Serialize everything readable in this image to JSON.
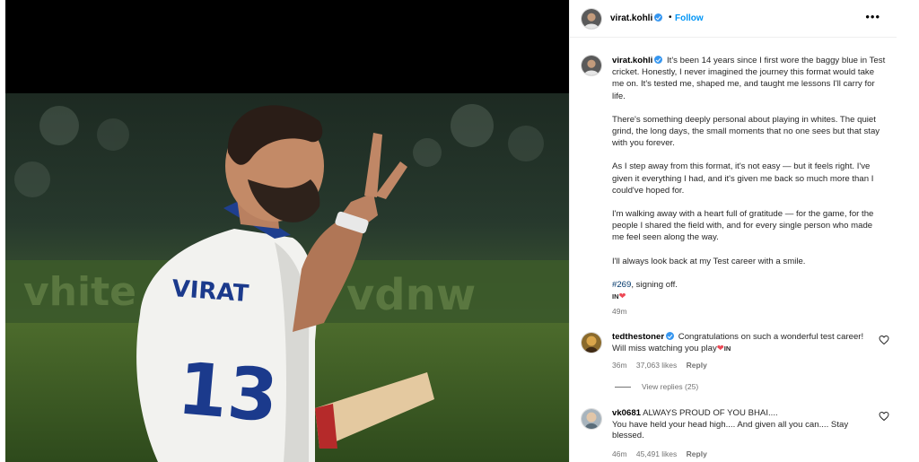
{
  "post": {
    "image_alt": "Virat Kohli in Test whites, number 13, raising two fingers while holding a bat"
  },
  "header": {
    "username": "virat.kohli",
    "separator": "•",
    "follow_label": "Follow",
    "more_label": "•••"
  },
  "caption": {
    "username": "virat.kohli",
    "paragraphs": [
      "It's been 14 years since I first wore the baggy blue in Test cricket. Honestly, I never imagined the journey this format would take me on. It's tested me, shaped me, and taught me lessons I'll carry for life.",
      "There's something deeply personal about playing in whites. The quiet grind, the long days, the small moments that no one sees but that stay with you forever.",
      "As I step away from this format, it's not easy — but it feels right. I've given it everything I had, and it's given me back so much more than I could've hoped for.",
      "I'm walking away with a heart full of gratitude — for the game, for the people I shared the field with, and for every single person who made me feel seen along the way.",
      "I'll always look back at my Test career with a smile."
    ],
    "hashtag": "#269",
    "closing": ", signing off.",
    "flag": "IN",
    "heart": "❤",
    "time": "49m"
  },
  "comments": [
    {
      "username": "tedthestoner",
      "text": "Congratulations on such a wonderful test career! Will miss watching you play",
      "heart": "❤",
      "flag": "IN",
      "time": "36m",
      "likes": "37,063 likes",
      "reply_label": "Reply",
      "view_replies": "View replies (25)"
    },
    {
      "username": "vk0681",
      "text_line1": "ALWAYS PROUD OF YOU BHAI....",
      "text_rest": "You have held your head high.... And given all you can.... Stay blessed.",
      "time": "46m",
      "likes": "45,491 likes",
      "reply_label": "Reply"
    }
  ],
  "colors": {
    "accent": "#0095f6",
    "verified": "#3797f0",
    "heart": "#ed4956",
    "muted": "#737373"
  }
}
